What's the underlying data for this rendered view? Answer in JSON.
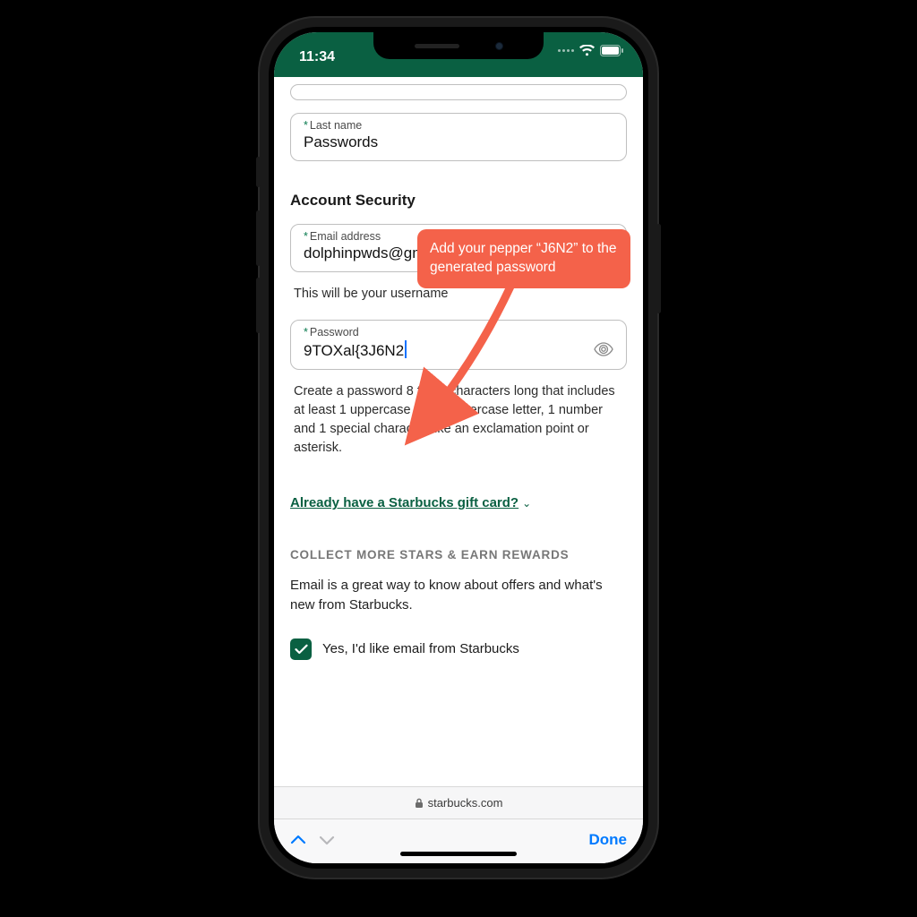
{
  "colors": {
    "brand_green": "#0a6042",
    "callout": "#f4624a",
    "ios_blue": "#007aff"
  },
  "statusbar": {
    "time": "11:34"
  },
  "form": {
    "last_name": {
      "label": "Last name",
      "value": "Passwords"
    },
    "section_title": "Account Security",
    "email": {
      "label": "Email address",
      "value": "dolphinpwds@gmail.com"
    },
    "username_hint": "This will be your username",
    "password": {
      "label": "Password",
      "value": "9TOXal{3J6N2"
    },
    "password_hint": "Create a password 8 to 25 characters long that includes at least 1 uppercase and 1 lowercase letter, 1 number and 1 special character like an exclamation point or asterisk."
  },
  "giftcard": {
    "link_text": "Already have a Starbucks gift card?"
  },
  "rewards": {
    "heading": "COLLECT MORE STARS & EARN REWARDS",
    "description": "Email is a great way to know about offers and what's new from Starbucks.",
    "checkbox_label": "Yes, I'd like email from Starbucks",
    "checked": true
  },
  "addressbar": {
    "domain": "starbucks.com"
  },
  "toolbar": {
    "done": "Done"
  },
  "callout": {
    "text": "Add your pepper “J6N2” to the generated password"
  }
}
